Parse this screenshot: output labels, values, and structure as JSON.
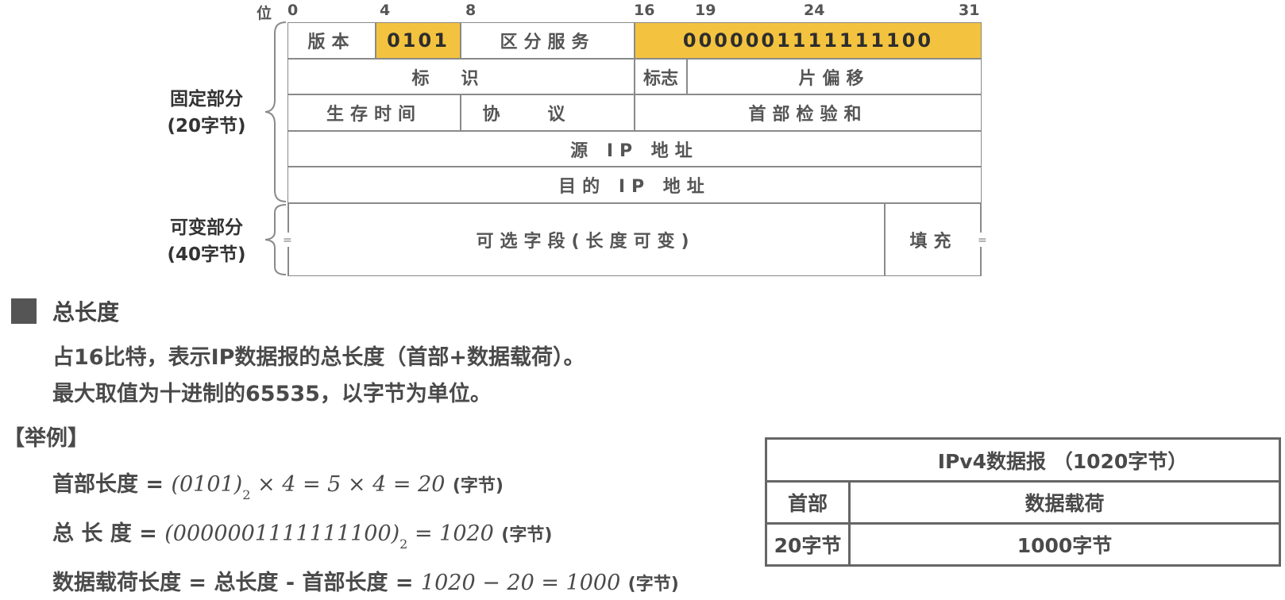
{
  "ruler": {
    "label": "位",
    "ticks": [
      "0",
      "4",
      "8",
      "16",
      "19",
      "24",
      "31"
    ]
  },
  "header": {
    "row1": {
      "version": "版本",
      "version_value": "0101",
      "dscp": "区分服务",
      "total_length_value": "0000001111111100"
    },
    "row2": {
      "identification": "标识",
      "flags": "标志",
      "fragment_offset": "片偏移"
    },
    "row3": {
      "ttl": "生存时间",
      "protocol": "协议",
      "checksum": "首部检验和"
    },
    "row4": {
      "source_ip": "源 IP 地址"
    },
    "row5": {
      "dest_ip": "目的 IP 地址"
    },
    "row6": {
      "options": "可选字段(长度可变)",
      "padding": "填充",
      "break_mark": "="
    }
  },
  "side_labels": {
    "fixed": "固定部分",
    "fixed_size": "(20字节)",
    "variable": "可变部分",
    "variable_size": "(40字节)"
  },
  "section": {
    "title": "总长度",
    "line1": "占16比特，表示IP数据报的总长度（首部+数据载荷）。",
    "line2": "最大取值为十进制的65535，以字节为单位。",
    "example": "【举例】"
  },
  "formulas": {
    "f1_label": "首部长度",
    "f1_eq": "=",
    "f1_math": "(0101)",
    "f1_sub": "2",
    "f1_rest": " × 4 = 5 × 4 = 20",
    "f1_unit": "(字节)",
    "f2_label": "总 长 度",
    "f2_eq": "=",
    "f2_math": "(0000001111111100)",
    "f2_sub": "2",
    "f2_rest": " = 1020",
    "f2_unit": "(字节)",
    "f3_label1": "数据载荷长度",
    "f3_eq1": "=",
    "f3_label2": "总长度",
    "f3_minus": "-",
    "f3_label3": "首部长度",
    "f3_eq2": "=",
    "f3_math": "1020 − 20 = 1000",
    "f3_unit": "(字节)"
  },
  "datagram_table": {
    "title": "IPv4数据报 （1020字节）",
    "col1_header": "首部",
    "col2_header": "数据载荷",
    "col1_value": "20字节",
    "col2_value": "1000字节"
  },
  "colors": {
    "highlight": "#f3c33f",
    "border": "#8a8a8a",
    "text": "#4a4a4a"
  }
}
